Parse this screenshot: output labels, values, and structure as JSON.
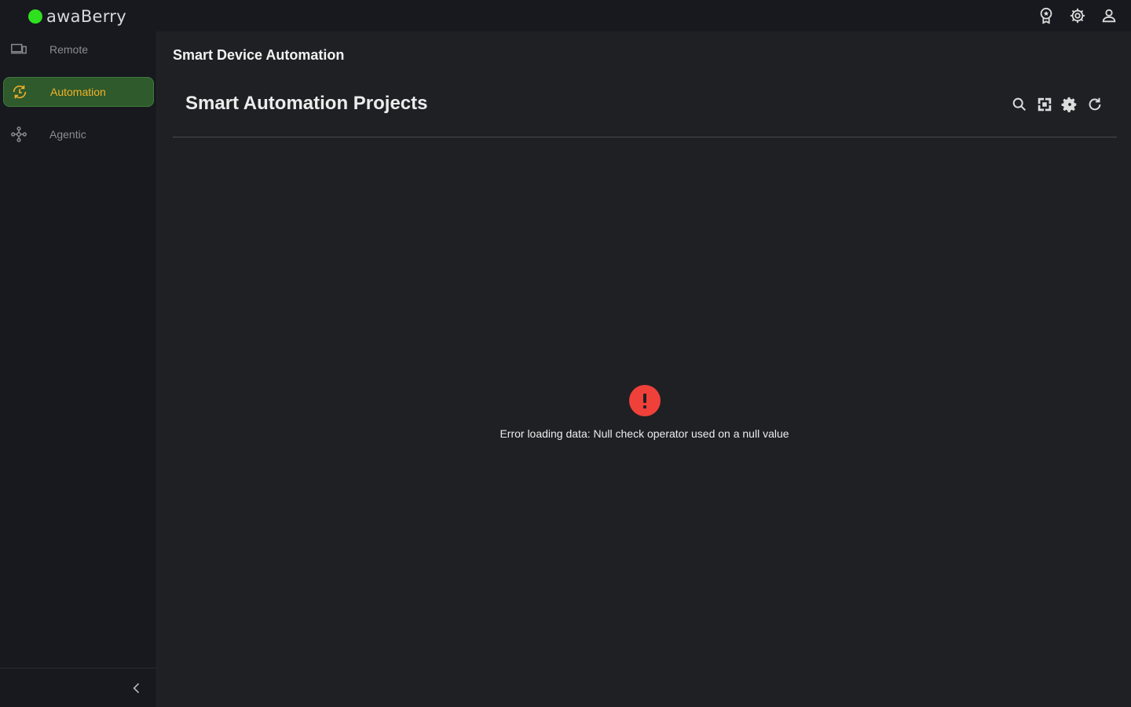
{
  "app": {
    "name": "awaBerry",
    "brand_color": "#2fe01e"
  },
  "topbar": {
    "icons": [
      "award-icon",
      "settings-icon",
      "account-icon"
    ]
  },
  "sidebar": {
    "items": [
      {
        "label": "Remote",
        "icon": "devices-icon",
        "active": false
      },
      {
        "label": "Automation",
        "icon": "automation-icon",
        "active": true
      },
      {
        "label": "Agentic",
        "icon": "agentic-icon",
        "active": false
      }
    ],
    "active_accent": "#f5b12a"
  },
  "main": {
    "page_title": "Smart Device Automation",
    "section_title": "Smart Automation Projects",
    "section_actions": [
      "search-icon",
      "fullscreen-icon",
      "settings-icon",
      "refresh-icon"
    ],
    "error": {
      "icon": "error-icon",
      "color": "#f0403a",
      "message": "Error loading data: Null check operator used on a null value"
    }
  }
}
